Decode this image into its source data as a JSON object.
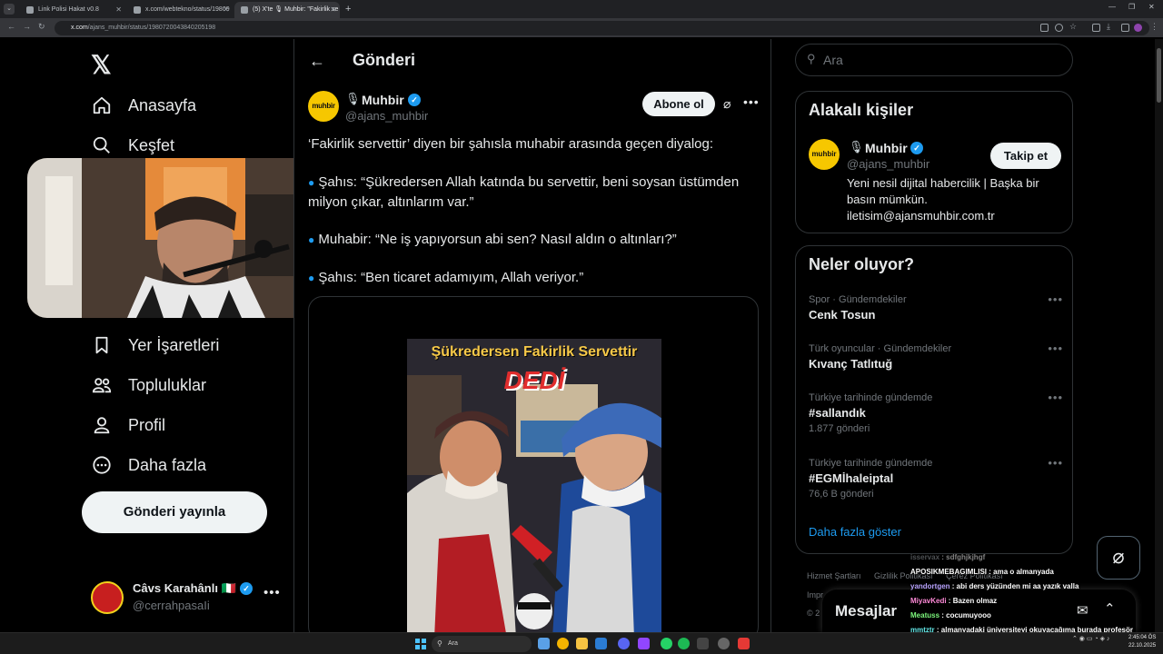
{
  "browser": {
    "tabs": [
      {
        "title": "Link Polisi Hakat v0.8"
      },
      {
        "title": "x.com/webtekno/status/19809"
      },
      {
        "title": "(5) X'te 🎙 Muhbir: \"Fakirlik se"
      }
    ],
    "url_domain": "x.com",
    "url_path": "/ajans_muhbir/status/1980720043840205198"
  },
  "leftnav": {
    "items": [
      {
        "label": "Anasayfa",
        "icon": "home-icon"
      },
      {
        "label": "Keşfet",
        "icon": "search-icon"
      },
      {
        "label": "Yer İşaretleri",
        "icon": "bookmark-icon"
      },
      {
        "label": "Topluluklar",
        "icon": "people-icon"
      },
      {
        "label": "Profil",
        "icon": "user-icon"
      },
      {
        "label": "Daha fazla",
        "icon": "more-circle-icon"
      }
    ],
    "post_button": "Gönderi yayınla",
    "account": {
      "name": "Câvs Karahânlı 🇮🇹",
      "handle": "@cerrahpasaIi"
    }
  },
  "main": {
    "title": "Gönderi",
    "author": {
      "name": "Muhbir",
      "handle": "@ajans_muhbir",
      "avatar_text": "muhbir"
    },
    "subscribe": "Abone ol",
    "text": [
      "‘Fakirlik servettir’ diyen bir şahısla muhabir arasında geçen diyalog:",
      "Şahıs: “Şükredersen Allah katında bu servettir, beni soysan üstümden milyon çıkar, altınlarım var.”",
      "Muhabir: “Ne iş yapıyorsun abi sen? Nasıl aldın o altınları?”",
      "Şahıs: “Ben ticaret adamıyım, Allah veriyor.”"
    ],
    "video": {
      "title": "Şükredersen Fakirlik Servettir",
      "subtitle": "DEDİ"
    }
  },
  "right": {
    "search_placeholder": "Ara",
    "related": {
      "title": "Alakalı kişiler",
      "name": "Muhbir",
      "handle": "@ajans_muhbir",
      "avatar_text": "muhbir",
      "follow": "Takip et",
      "bio": "Yeni nesil dijital habercilik | Başka bir basın mümkün. iletisim@ajansmuhbir.com.tr"
    },
    "trends": {
      "title": "Neler oluyor?",
      "items": [
        {
          "meta": "Spor · Gündemdekiler",
          "name": "Cenk Tosun",
          "count": ""
        },
        {
          "meta": "Türk oyuncular · Gündemdekiler",
          "name": "Kıvanç Tatlıtuğ",
          "count": ""
        },
        {
          "meta": "Türkiye tarihinde gündemde",
          "name": "#sallandık",
          "count": "1.877 gönderi"
        },
        {
          "meta": "Türkiye tarihinde gündemde",
          "name": "#EGMİhaleiptal",
          "count": "76,6 B gönderi"
        }
      ],
      "show_more": "Daha fazla göster"
    },
    "footer": {
      "links": [
        "Hizmet Şartları",
        "Gizlilik Politikası",
        "Çerez Politikası"
      ],
      "more": "Impr",
      "copy": "© 2"
    },
    "messages": "Mesajlar"
  },
  "chat": [
    {
      "user": "isservax",
      "text": "sdfghjkjhgf",
      "color": "#9aa0a6"
    },
    {
      "user": "APOSIKMEBAGIMLISI",
      "text": "ama o almanyada",
      "color": "#ffffff"
    },
    {
      "user": "yandortgen",
      "text": "abi ders yüzünden mi aa yazık valla",
      "color": "#b9a3ff"
    },
    {
      "user": "MiyavKedi",
      "text": "Bazen olmaz",
      "color": "#ff8ad8"
    },
    {
      "user": "Meatuss",
      "text": "cocumuyooo",
      "color": "#7cf57c"
    },
    {
      "user": "mmtztr",
      "text": "almanyadaki üniversiteyi okuyacağıma burada profesör olabiliyosun",
      "color": "#63e6e6"
    }
  ],
  "taskbar": {
    "search": "Ara",
    "time": "2:45:04 ÖS",
    "date": "22.10.2025"
  }
}
